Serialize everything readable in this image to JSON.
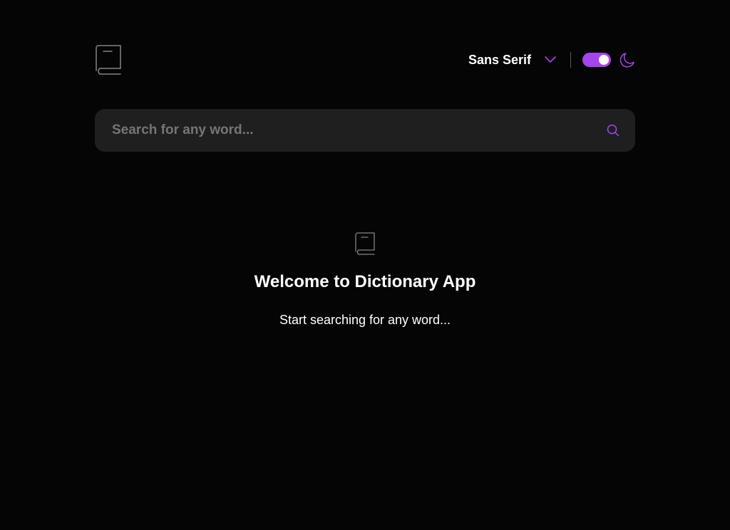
{
  "header": {
    "logo_icon": "book-icon",
    "font_selector": {
      "label": "Sans Serif",
      "icon": "chevron-down-icon"
    },
    "theme_toggle": {
      "state": "on",
      "icon": "moon-icon"
    }
  },
  "search": {
    "placeholder": "Search for any word...",
    "value": "",
    "icon": "search-icon"
  },
  "welcome": {
    "icon": "book-icon",
    "title": "Welcome to Dictionary App",
    "subtitle": "Start searching for any word..."
  },
  "colors": {
    "accent": "#a445ed",
    "background": "#050505",
    "search_background": "#1f1f1f",
    "icon_gray": "#838383",
    "placeholder": "#757575",
    "text": "#ffffff"
  }
}
